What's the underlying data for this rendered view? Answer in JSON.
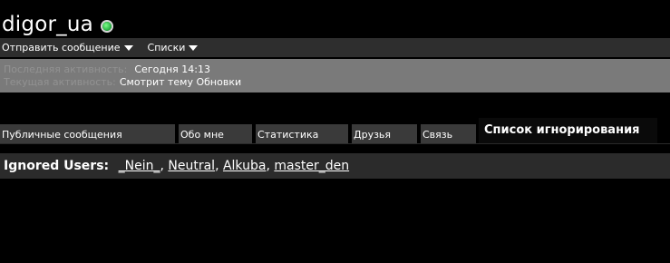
{
  "profile": {
    "username": "digor_ua",
    "status": "online"
  },
  "menu": {
    "send_message": "Отправить сообщение",
    "lists": "Списки"
  },
  "activity": {
    "last_label": "Последняя активность:",
    "last_value": "Сегодня 14:13",
    "current_label": "Текущая активность:",
    "current_value": "Смотрит тему Обновки"
  },
  "tabs": [
    {
      "label": "Публичные сообщения"
    },
    {
      "label": "Обо мне"
    },
    {
      "label": "Статистика"
    },
    {
      "label": "Друзья"
    },
    {
      "label": "Связь"
    },
    {
      "label": "Список игнорирования"
    }
  ],
  "ignored": {
    "label": "Ignored Users:",
    "users": [
      "_Nein_",
      "Neutral",
      "Alkuba",
      "master_den"
    ]
  },
  "colors": {
    "background": "#000000",
    "online": "#2ecc40"
  }
}
